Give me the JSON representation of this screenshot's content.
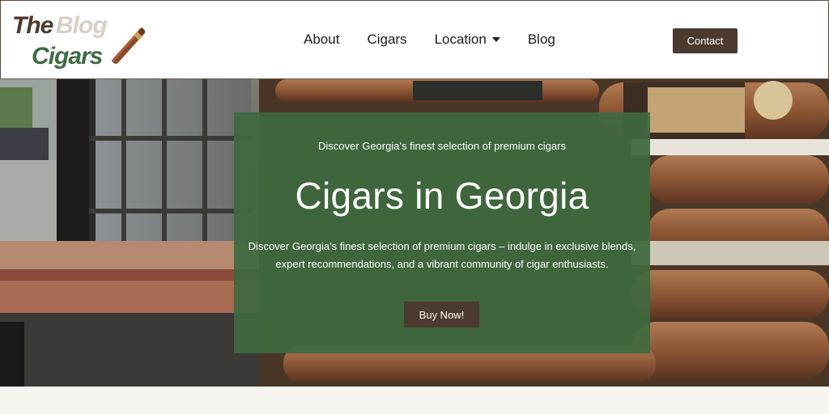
{
  "logo": {
    "line1a": "The",
    "line1b": "Blog",
    "line2": "Cigars"
  },
  "nav": {
    "items": [
      {
        "label": "About"
      },
      {
        "label": "Cigars"
      },
      {
        "label": "Location"
      },
      {
        "label": "Blog"
      }
    ],
    "contact_label": "Contact"
  },
  "hero": {
    "kicker": "Discover Georgia's finest selection of premium cigars",
    "title": "Cigars in Georgia",
    "description": "Discover Georgia's finest selection of premium cigars – indulge in exclusive blends, expert recommendations, and a vibrant community of cigar enthusiasts.",
    "cta_label": "Buy Now!"
  },
  "colors": {
    "brand_brown": "#4b3a30",
    "brand_green": "#3f6b42",
    "overlay_green": "#3e6840",
    "page_bg": "#f7f5f0"
  },
  "icons": {
    "dropdown": "chevron-down-icon",
    "logo_cigar": "cigar-icon"
  }
}
